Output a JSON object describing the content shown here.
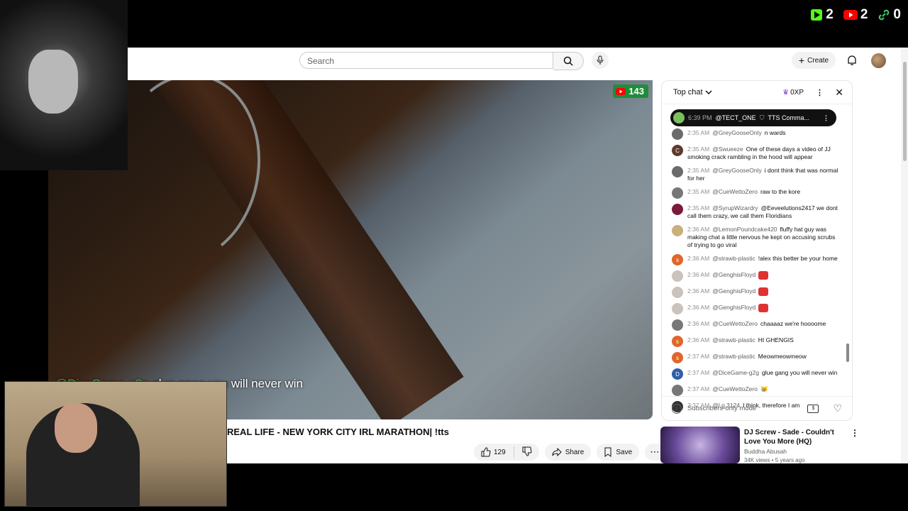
{
  "stats": [
    {
      "icon": "play-icon",
      "value": "2",
      "color": "#53fc18"
    },
    {
      "icon": "youtube-icon",
      "value": "2",
      "color": "#ff0000"
    },
    {
      "icon": "link-icon",
      "value": "0",
      "color": "#3fcf6a"
    }
  ],
  "header": {
    "search_placeholder": "Search",
    "create_label": "Create"
  },
  "video": {
    "viewer_count": "143",
    "caption_user": "@DiceGame-g2g",
    "caption_text": "glue gang you will never win",
    "title": "REAL LIFE - NEW YORK CITY IRL MARATHON| !tts"
  },
  "actions": {
    "like_count": "129",
    "share_label": "Share",
    "save_label": "Save"
  },
  "chat": {
    "mode_label": "Top chat",
    "xp_label": "0XP",
    "pinned": {
      "time": "6:39 PM",
      "user": "@TECT_ONE",
      "text": "TTS Comma..."
    },
    "messages": [
      {
        "time": "2:35 AM",
        "user": "@GreyGooseOnly",
        "text": "n wards",
        "avatar_color": "#6b6b6b",
        "letter": ""
      },
      {
        "time": "2:35 AM",
        "user": "@Swueeze",
        "text": "One of these days a video of JJ smoking crack rambling in the hood will appear",
        "avatar_color": "#5d3a2a",
        "letter": "C"
      },
      {
        "time": "2:35 AM",
        "user": "@GreyGooseOnly",
        "text": "i dont think that was normal for her",
        "avatar_color": "#6b6b6b",
        "letter": ""
      },
      {
        "time": "2:35 AM",
        "user": "@CueWettoZero",
        "text": "raw to the kore",
        "avatar_color": "#777",
        "letter": ""
      },
      {
        "time": "2:35 AM",
        "user": "@SyrupWizardry",
        "text": "@Eeveelutions2417 we dont call them crazy, we call them Floridians",
        "avatar_color": "#7a1b3a",
        "letter": ""
      },
      {
        "time": "2:36 AM",
        "user": "@LemonPoundcake420",
        "text": "fluffy hat guy was making chat a little nervous he kept on accusing scrubs of trying to go viral",
        "avatar_color": "#c9b07a",
        "letter": ""
      },
      {
        "time": "2:36 AM",
        "user": "@strawb-plastic",
        "text": "!alex this better be your home",
        "avatar_color": "#e0662a",
        "letter": "s"
      },
      {
        "time": "2:36 AM",
        "user": "@GenghisFloyd",
        "text": "",
        "avatar_color": "#c9c2bd",
        "letter": "",
        "emoji": true
      },
      {
        "time": "2:36 AM",
        "user": "@GenghisFloyd",
        "text": "",
        "avatar_color": "#c9c2bd",
        "letter": "",
        "emoji": true
      },
      {
        "time": "2:36 AM",
        "user": "@GenghisFloyd",
        "text": "",
        "avatar_color": "#c9c2bd",
        "letter": "",
        "emoji": true
      },
      {
        "time": "2:36 AM",
        "user": "@CueWettoZero",
        "text": "chaaaaz we're hoooome",
        "avatar_color": "#777",
        "letter": ""
      },
      {
        "time": "2:36 AM",
        "user": "@strawb-plastic",
        "text": "HI GHENGIS",
        "avatar_color": "#e0662a",
        "letter": "s"
      },
      {
        "time": "2:37 AM",
        "user": "@strawb-plastic",
        "text": "Meowmeowmeow",
        "avatar_color": "#e0662a",
        "letter": "s"
      },
      {
        "time": "2:37 AM",
        "user": "@DiceGame-g2g",
        "text": "glue gang you will never win",
        "avatar_color": "#2f5fa8",
        "letter": "D"
      },
      {
        "time": "2:37 AM",
        "user": "@CueWettoZero",
        "text": "😿",
        "avatar_color": "#777",
        "letter": ""
      },
      {
        "time": "2:37 AM",
        "user": "@l.g.3124",
        "text": "I think, therefore I am",
        "avatar_color": "#333",
        "letter": ""
      }
    ],
    "footer_label": "Subscribers-only mode"
  },
  "recommended": {
    "title": "DJ Screw - Sade - Couldn't Love You More (HQ)",
    "channel": "Buddha Abusah",
    "meta": "34K views • 5 years ago"
  }
}
